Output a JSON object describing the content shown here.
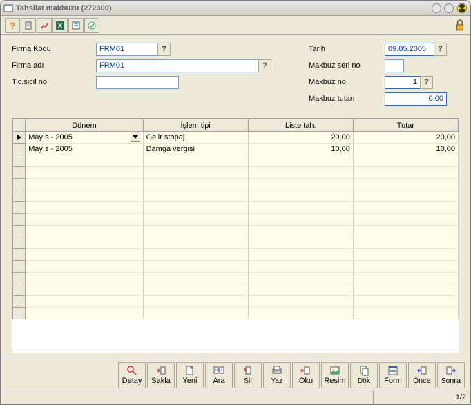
{
  "window": {
    "title": "Tahsilat makbuzu (272300)"
  },
  "form": {
    "firma_kodu_label": "Firma Kodu",
    "firma_kodu_value": "FRM01",
    "firma_adi_label": "Firma adı",
    "firma_adi_value": "FRM01",
    "tic_sicil_label": "Tic.sicil no",
    "tic_sicil_value": "",
    "tarih_label": "Tarih",
    "tarih_value": "09.05.2005",
    "makbuz_seri_label": "Makbuz seri no",
    "makbuz_seri_value": "",
    "makbuz_no_label": "Makbuz no",
    "makbuz_no_value": "1",
    "makbuz_tutar_label": "Makbuz tutarı",
    "makbuz_tutar_value": "0,00"
  },
  "grid": {
    "headers": {
      "donem": "Dönem",
      "islem": "İşlem tipi",
      "liste": "Liste tah.",
      "tutar": "Tutar"
    },
    "rows": [
      {
        "donem": "Mayıs   - 2005",
        "islem": "Gelir stopaj",
        "liste": "20,00",
        "tutar": "20,00",
        "selected": true
      },
      {
        "donem": "Mayıs   - 2005",
        "islem": "Damga vergisi",
        "liste": "10,00",
        "tutar": "10,00",
        "selected": false
      }
    ]
  },
  "buttons": {
    "detay": "Detay",
    "sakla": "Sakla",
    "yeni": "Yeni",
    "ara": "Ara",
    "sil": "Sil",
    "yaz": "Yaz",
    "oku": "Oku",
    "resim": "Resim",
    "dok": "Dök",
    "form": "Form",
    "once": "Önce",
    "sonra": "Sonra"
  },
  "status": {
    "page": "1/2"
  },
  "icons": {
    "help": "?",
    "dropdown": "▾"
  }
}
